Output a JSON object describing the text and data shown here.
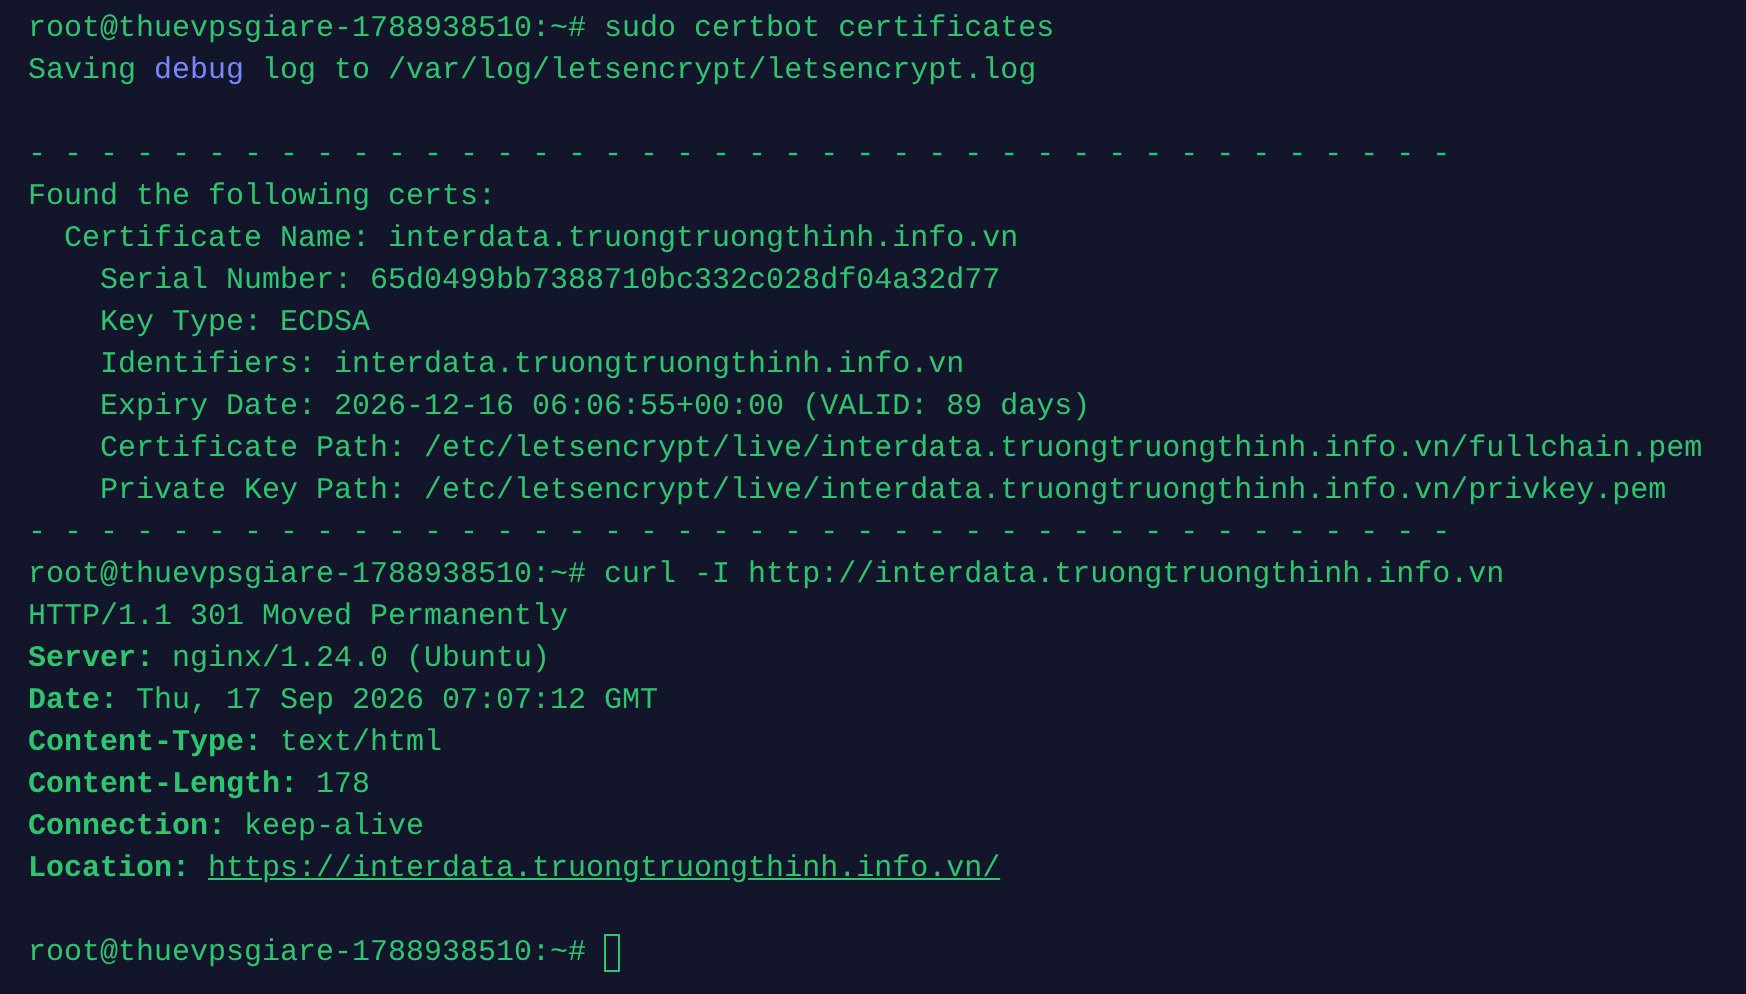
{
  "terminal": {
    "lines": [
      {
        "kind": "prompt",
        "prompt": "root@thuevpsgiare-1788938510:~#",
        "command": "sudo certbot certificates",
        "cursor": false
      },
      {
        "kind": "output",
        "segments": [
          {
            "text": "Saving ",
            "highlight": false
          },
          {
            "text": "debug",
            "highlight": true
          },
          {
            "text": " log to /var/log/letsencrypt/letsencrypt.log",
            "highlight": false
          }
        ]
      },
      {
        "kind": "blank"
      },
      {
        "kind": "rule",
        "text": "- - - - - - - - - - - - - - - - - - - - - - - - - - - - - - - - - - - - - - - -"
      },
      {
        "kind": "output",
        "segments": [
          {
            "text": "Found the following certs:",
            "highlight": false
          }
        ]
      },
      {
        "kind": "output",
        "segments": [
          {
            "text": "  Certificate Name: interdata.truongtruongthinh.info.vn",
            "highlight": false
          }
        ]
      },
      {
        "kind": "output",
        "segments": [
          {
            "text": "    Serial Number: 65d0499bb7388710bc332c028df04a32d77",
            "highlight": false
          }
        ]
      },
      {
        "kind": "output",
        "segments": [
          {
            "text": "    Key Type: ECDSA",
            "highlight": false
          }
        ]
      },
      {
        "kind": "output",
        "segments": [
          {
            "text": "    Identifiers: interdata.truongtruongthinh.info.vn",
            "highlight": false
          }
        ]
      },
      {
        "kind": "output",
        "segments": [
          {
            "text": "    Expiry Date: 2026-12-16 06:06:55+00:00 (VALID: 89 days)",
            "highlight": false
          }
        ]
      },
      {
        "kind": "output",
        "segments": [
          {
            "text": "    Certificate Path: /etc/letsencrypt/live/interdata.truongtruongthinh.info.vn/fullchain.pem",
            "highlight": false
          }
        ]
      },
      {
        "kind": "output",
        "segments": [
          {
            "text": "    Private Key Path: /etc/letsencrypt/live/interdata.truongtruongthinh.info.vn/privkey.pem",
            "highlight": false
          }
        ]
      },
      {
        "kind": "rule",
        "text": "- - - - - - - - - - - - - - - - - - - - - - - - - - - - - - - - - - - - - - - -"
      },
      {
        "kind": "prompt",
        "prompt": "root@thuevpsgiare-1788938510:~#",
        "command": "curl -I http://interdata.truongtruongthinh.info.vn",
        "cursor": false
      },
      {
        "kind": "output",
        "segments": [
          {
            "text": "HTTP/1.1 301 Moved Permanently",
            "highlight": false
          }
        ]
      },
      {
        "kind": "header",
        "name": "Server:",
        "value": "nginx/1.24.0 (Ubuntu)",
        "link": false
      },
      {
        "kind": "header",
        "name": "Date:",
        "value": "Thu, 17 Sep 2026 07:07:12 GMT",
        "link": false
      },
      {
        "kind": "header",
        "name": "Content-Type:",
        "value": "text/html",
        "link": false
      },
      {
        "kind": "header",
        "name": "Content-Length:",
        "value": "178",
        "link": false
      },
      {
        "kind": "header",
        "name": "Connection:",
        "value": "keep-alive",
        "link": false
      },
      {
        "kind": "header",
        "name": "Location:",
        "value": "https://interdata.truongtruongthinh.info.vn/",
        "link": true
      },
      {
        "kind": "blank"
      },
      {
        "kind": "prompt",
        "prompt": "root@thuevpsgiare-1788938510:~#",
        "cursor": true
      }
    ]
  }
}
